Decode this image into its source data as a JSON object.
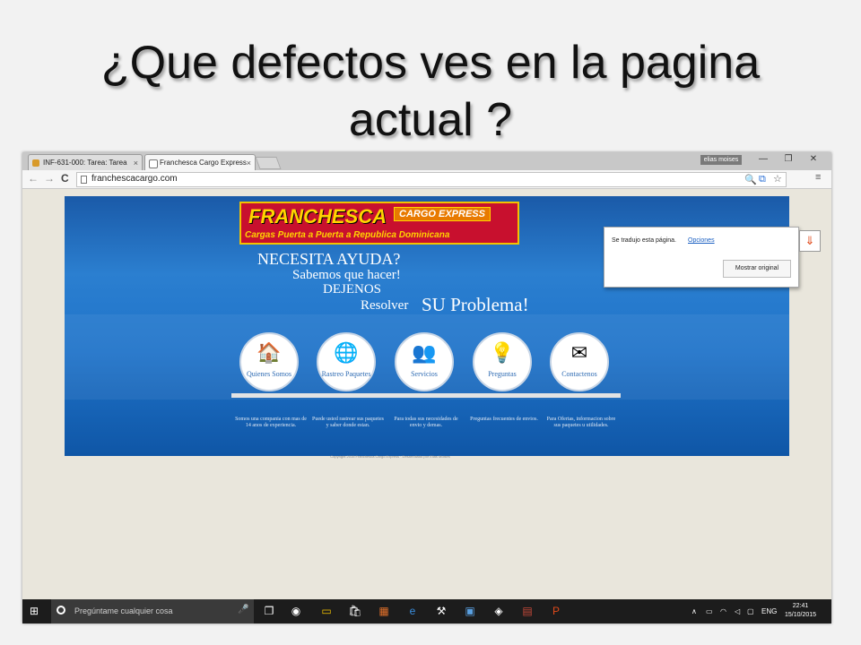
{
  "slide": {
    "title_line1": "¿Que defectos ves en la pagina",
    "title_line2": "actual ?"
  },
  "browser": {
    "tabs": [
      {
        "label": "INF-631-000: Tarea: Tarea",
        "active": false
      },
      {
        "label": "Franchesca Cargo Express",
        "active": true
      }
    ],
    "user_badge": "elias moises",
    "window_controls": [
      "—",
      "❐",
      "✕"
    ],
    "nav": {
      "back": "←",
      "forward": "→",
      "reload": "C"
    },
    "url": "franchescacargo.com",
    "toolbar_icons": {
      "zoom": "🔍",
      "translate": "⧉",
      "star": "☆",
      "menu": "≡"
    }
  },
  "site": {
    "logo_name": "FRANCHESCA",
    "logo_tag": "CARGO EXPRESS",
    "logo_sub": "Cargas Puerta a Puerta a Republica Dominicana",
    "help": {
      "line1": "NECESITA AYUDA?",
      "line2": "Sabemos que hacer!",
      "line3": "DEJENOS",
      "line4": "Resolver",
      "line5": "SU Problema!"
    },
    "menu": [
      {
        "label": "Quienes Somos",
        "icon": "house-icon",
        "glyph": "🏠",
        "desc": "Somos una compania con mas de 14 anos de experiencia."
      },
      {
        "label": "Rastreo Paquetes",
        "icon": "globe-icon",
        "glyph": "🌐",
        "desc": "Puede usted rastrear sus paquetes y saber donde estan."
      },
      {
        "label": "Servicios",
        "icon": "people-icon",
        "glyph": "👥",
        "desc": "Para todas sus necesidades de envio y demas."
      },
      {
        "label": "Preguntas",
        "icon": "lightbulb-icon",
        "glyph": "💡",
        "desc": "Preguntas frecuentes de envios."
      },
      {
        "label": "Contactenos",
        "icon": "mail-icon",
        "glyph": "✉",
        "desc": "Para Ofertas, informacion sobre sus paquetes u utilidades."
      }
    ],
    "copyright": "Copyright 2015 Franchesca Cargo Express · Desarrollado por Elias Moises"
  },
  "translate_popup": {
    "message": "Se tradujo esta página.",
    "options_link": "Opciones",
    "show_original": "Mostrar original"
  },
  "taskbar": {
    "search_placeholder": "Pregúntame cualquier cosa",
    "language": "ENG",
    "time": "22:41",
    "date": "15/10/2015"
  }
}
